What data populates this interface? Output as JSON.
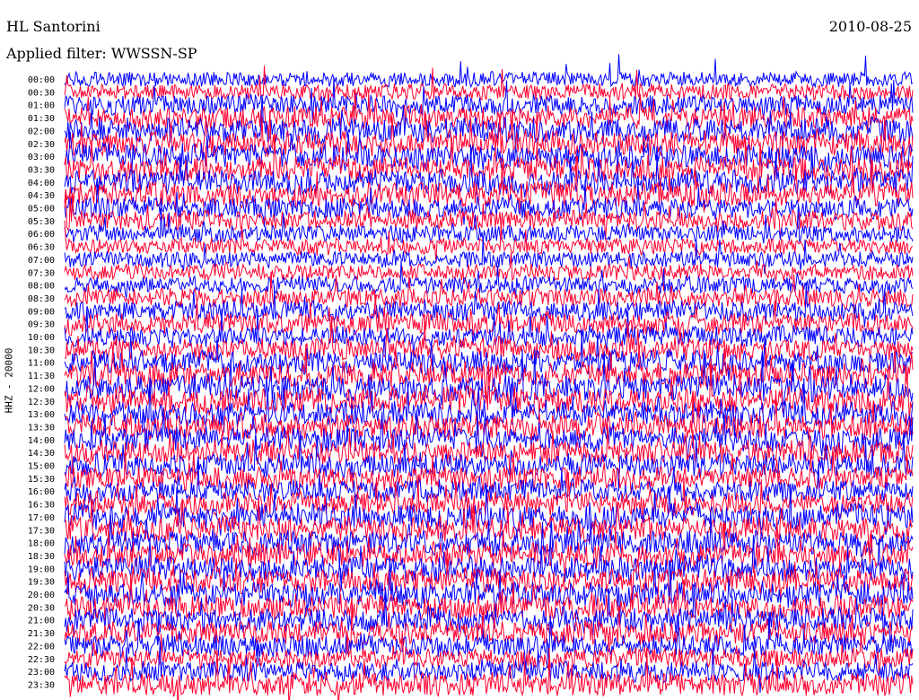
{
  "header": {
    "station": "HL Santorini",
    "date": "2010-08-25",
    "filter": "Applied filter: WWSSN-SP"
  },
  "chart_data": {
    "type": "line",
    "title": "HL Santorini",
    "subtitle": "Applied filter: WWSSN-SP",
    "ylabel": "HHZ - 20000",
    "xlabel": "",
    "row_labels": [
      "00:00",
      "00:30",
      "01:00",
      "01:30",
      "02:00",
      "02:30",
      "03:00",
      "03:30",
      "04:00",
      "04:30",
      "05:00",
      "05:30",
      "06:00",
      "06:30",
      "07:00",
      "07:30",
      "08:00",
      "08:30",
      "09:00",
      "09:30",
      "10:00",
      "10:30",
      "11:00",
      "11:30",
      "12:00",
      "12:30",
      "13:00",
      "13:30",
      "14:00",
      "14:30",
      "15:00",
      "15:30",
      "16:00",
      "16:30",
      "17:00",
      "17:30",
      "18:00",
      "18:30",
      "19:00",
      "19:30",
      "20:00",
      "20:30",
      "21:00",
      "21:30",
      "22:00",
      "22:30",
      "23:00",
      "23:30"
    ],
    "series_colors": [
      "#0000ff",
      "#ff0030"
    ],
    "row_noise_level": [
      0.35,
      0.4,
      0.6,
      0.8,
      0.9,
      0.9,
      0.9,
      0.9,
      0.9,
      0.9,
      0.7,
      0.6,
      0.45,
      0.4,
      0.4,
      0.4,
      0.45,
      0.55,
      0.6,
      0.7,
      0.6,
      0.7,
      0.8,
      0.9,
      1.0,
      1.0,
      0.9,
      0.9,
      0.9,
      0.8,
      0.8,
      0.8,
      0.7,
      0.8,
      0.9,
      0.9,
      0.9,
      0.9,
      0.9,
      0.9,
      0.9,
      0.9,
      0.9,
      0.8,
      0.7,
      0.6,
      0.6,
      0.8
    ]
  }
}
